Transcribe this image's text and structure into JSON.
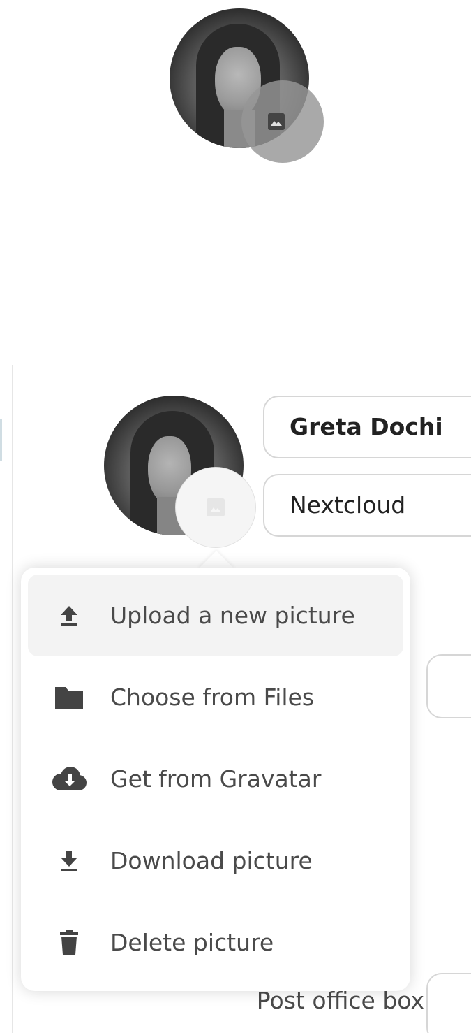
{
  "top_preview": {
    "icon": "image-icon"
  },
  "profile": {
    "display_name": "Greta Dochi",
    "organisation": "Nextcloud"
  },
  "avatar_menu": {
    "trigger_icon": "image-icon",
    "items": [
      {
        "label": "Upload a new picture",
        "icon": "upload-icon",
        "active": true
      },
      {
        "label": "Choose from Files",
        "icon": "folder-icon",
        "active": false
      },
      {
        "label": "Get from Gravatar",
        "icon": "cloud-download-icon",
        "active": false
      },
      {
        "label": "Download picture",
        "icon": "download-icon",
        "active": false
      },
      {
        "label": "Delete picture",
        "icon": "trash-icon",
        "active": false
      }
    ]
  },
  "address": {
    "post_office_box_label": "Post office box"
  },
  "colors": {
    "icon": "#444444",
    "menu_text": "#4a4a4a",
    "active_row": "#f3f3f3",
    "border": "#d6d6d6"
  }
}
